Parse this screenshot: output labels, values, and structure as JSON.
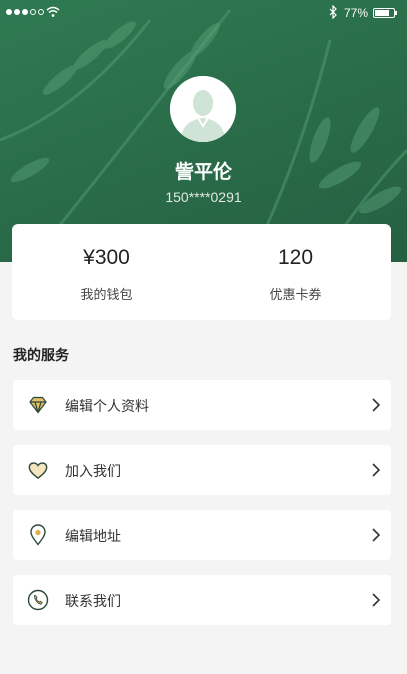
{
  "status_bar": {
    "battery": "77%",
    "battery_level": 0.77
  },
  "profile": {
    "name": "訾平伦",
    "phone": "150****0291"
  },
  "stats": [
    {
      "value": "¥300",
      "label": "我的钱包"
    },
    {
      "value": "120",
      "label": "优惠卡券"
    }
  ],
  "services": {
    "title": "我的服务",
    "items": [
      {
        "label": "编辑个人资料",
        "icon": "diamond-icon"
      },
      {
        "label": "加入我们",
        "icon": "heart-icon"
      },
      {
        "label": "编辑地址",
        "icon": "location-pin-icon"
      },
      {
        "label": "联系我们",
        "icon": "phone-icon"
      }
    ]
  },
  "colors": {
    "header_green": "#2a6e4a",
    "icon_accent": "#e0b24a",
    "icon_stroke": "#2c4a3a"
  }
}
